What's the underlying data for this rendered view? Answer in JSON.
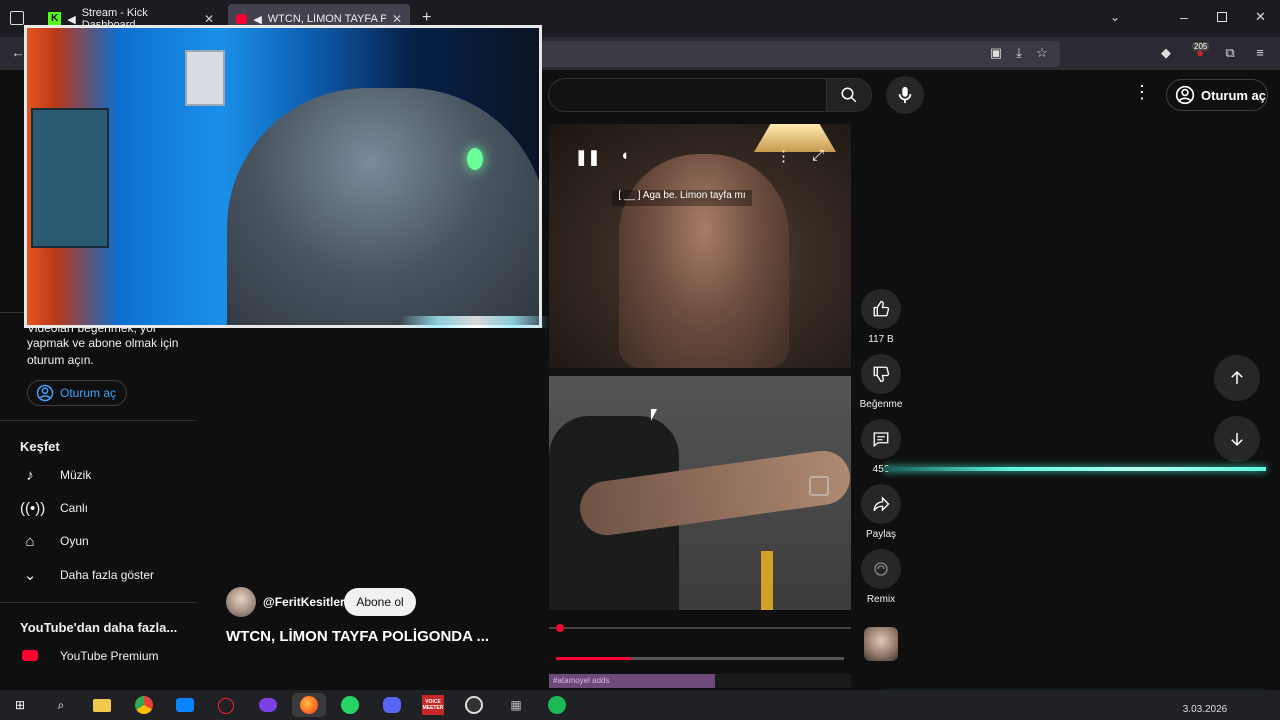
{
  "browser": {
    "tabs": [
      {
        "label": "Stream - Kick Dashboard",
        "active": false,
        "icon": "kick-icon"
      },
      {
        "label": "WTCN, LİMON TAYFA POLİG",
        "active": true,
        "icon": "youtube-icon"
      }
    ],
    "new_tab": "+",
    "badge_count": "205"
  },
  "youtube": {
    "signin_label": "Oturum aç",
    "sidebar": {
      "signin_prompt": "Videoları beğenmek, yorum yapmak ve abone olmak için oturum açın.",
      "signin_prompt_line1": "Videoları beğenmek, yor",
      "signin_prompt_line2": "yapmak ve abone olmak için",
      "signin_prompt_line3": "oturum açın.",
      "signin_button": "Oturum aç",
      "explore_heading": "Keşfet",
      "explore_items": [
        {
          "label": "Müzik",
          "icon": "music-note-icon"
        },
        {
          "label": "Canlı",
          "icon": "live-icon"
        },
        {
          "label": "Oyun",
          "icon": "gamepad-icon"
        },
        {
          "label": "Daha fazla göster",
          "icon": "chevron-down-icon"
        }
      ],
      "more_heading": "YouTube'dan daha fazla...",
      "more_items": [
        {
          "label": "YouTube Premium",
          "icon": "youtube-premium-icon"
        }
      ]
    },
    "short": {
      "subtitle": "[ __ ] Aga be. Limon tayfa mı",
      "channel": "@FeritKesitler",
      "subscribe": "Abone ol",
      "title": "WTCN, LİMON TAYFA POLİGONDA ...",
      "progress": 0.26,
      "channel_strip_text": "#atamoyel adds"
    },
    "actions": [
      {
        "label": "117 B",
        "icon": "thumbs-up-icon"
      },
      {
        "label": "Beğenme",
        "icon": "thumbs-down-icon"
      },
      {
        "label": "456",
        "icon": "comment-icon"
      },
      {
        "label": "Paylaş",
        "icon": "share-icon"
      },
      {
        "label": "Remix",
        "icon": "remix-icon"
      }
    ]
  },
  "taskbar": {
    "date": "3.03.2026",
    "apps": [
      "windows-start-icon",
      "search-icon",
      "file-explorer-icon",
      "chrome-icon",
      "mail-icon",
      "opera-icon",
      "app-icon",
      "firefox-icon",
      "whatsapp-icon",
      "discord-icon",
      "voicemeeter-icon",
      "obs-icon",
      "apps-grid-icon",
      "spotify-icon"
    ],
    "voicemeeter_label": "VOICE MEETER"
  },
  "colors": {
    "accent_red": "#ff0033",
    "link_blue": "#3ea6ff",
    "glow_teal": "#5ff7e0"
  }
}
